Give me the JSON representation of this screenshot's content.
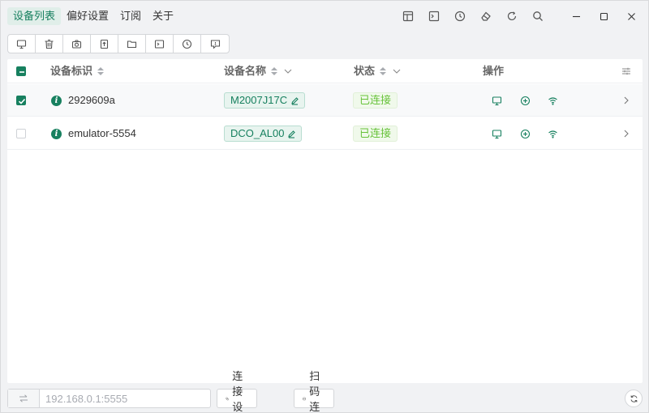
{
  "menu": {
    "items": [
      {
        "label": "设备列表",
        "active": true
      },
      {
        "label": "偏好设置",
        "active": false
      },
      {
        "label": "订阅",
        "active": false
      },
      {
        "label": "关于",
        "active": false
      }
    ]
  },
  "titlebar_icons": [
    "layout-icon",
    "terminal-icon",
    "history-icon",
    "eraser-icon",
    "refresh-icon",
    "search-icon"
  ],
  "window_controls": [
    "minimize-icon",
    "maximize-icon",
    "close-icon"
  ],
  "toolbar_icons": [
    "monitor-icon",
    "trash-icon",
    "camera-icon",
    "upload-file-icon",
    "folder-icon",
    "terminal-icon",
    "history-icon",
    "message-icon"
  ],
  "table": {
    "headers": {
      "serial": "设备标识",
      "name": "设备名称",
      "status": "状态",
      "actions": "操作"
    },
    "rows": [
      {
        "serial": "2929609a",
        "name": "M2007J17C",
        "status": "已连接",
        "selected": true
      },
      {
        "serial": "emulator-5554",
        "name": "DCO_AL00",
        "status": "已连接",
        "selected": false
      }
    ]
  },
  "bottom": {
    "address_placeholder": "192.168.0.1:5555",
    "address_value": "",
    "connect_label": "连接设备",
    "qr_label": "扫码连接"
  },
  "colors": {
    "accent": "#17805f",
    "status_green": "#67c23a",
    "status_bg": "#f0f9eb"
  }
}
